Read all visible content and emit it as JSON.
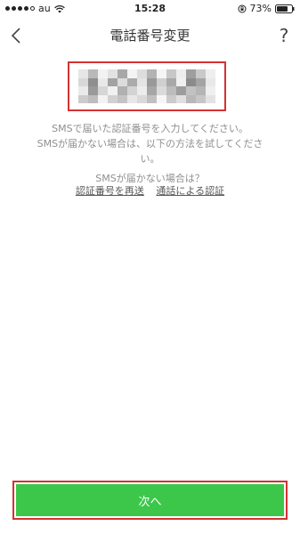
{
  "status_bar": {
    "carrier": "au",
    "time": "15:28",
    "battery": "73%"
  },
  "nav": {
    "title": "電話番号変更",
    "help": "?"
  },
  "instructions": {
    "line1": "SMSで届いた認証番号を入力してください。",
    "line2": "SMSが届かない場合は、以下の方法を試してくださ",
    "line2b": "い。",
    "line3": "SMSが届かない場合は？"
  },
  "links": {
    "resend": "認証番号を再送",
    "call": "通話による認証"
  },
  "next_button": {
    "label": "次へ"
  },
  "colors": {
    "accent_green": "#3cc74b",
    "highlight_red": "#d43232"
  }
}
